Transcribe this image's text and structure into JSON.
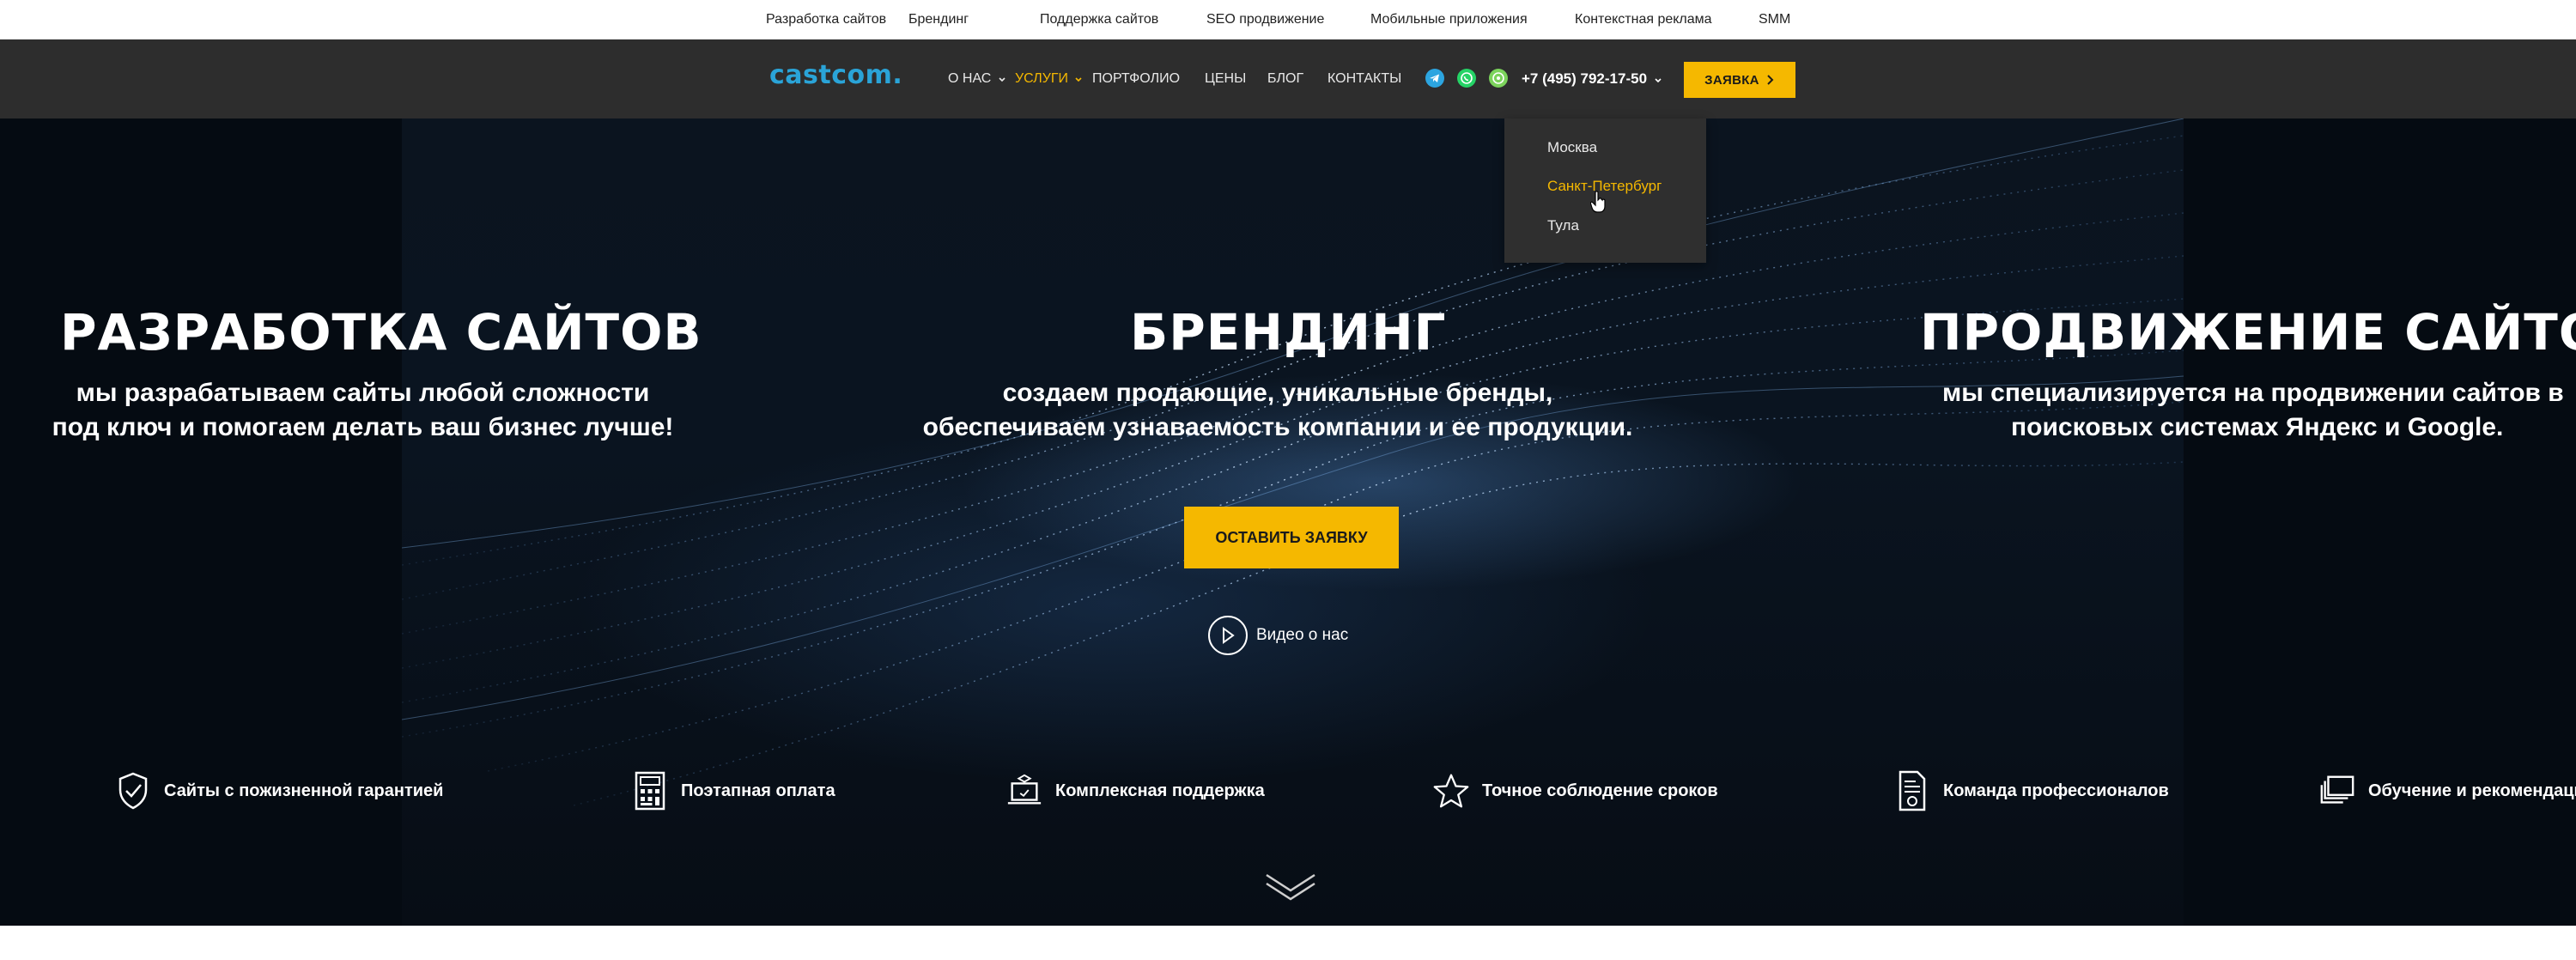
{
  "top_links": [
    "Разработка сайтов",
    "Брендинг",
    "Поддержка сайтов",
    "SEO продвижение",
    "Мобильные приложения",
    "Контекстная реклама",
    "SMM"
  ],
  "header": {
    "logo": "castcom.",
    "nav": [
      {
        "label": "О НАС",
        "has_caret": true
      },
      {
        "label": "УСЛУГИ",
        "has_caret": true,
        "active": true
      },
      {
        "label": "ПОРТФОЛИО"
      },
      {
        "label": "ЦЕНЫ"
      },
      {
        "label": "БЛОГ"
      },
      {
        "label": "КОНТАКТЫ"
      }
    ],
    "social_icons": [
      "telegram-icon",
      "whatsapp-icon",
      "viber-icon"
    ],
    "phone": "+7 (495) 792-17-50",
    "cta_label": "ЗАЯВКА"
  },
  "city_dropdown": {
    "items": [
      "Москва",
      "Санкт-Петербург",
      "Тула"
    ],
    "hovered": "Санкт-Петербург"
  },
  "hero": {
    "slides": [
      {
        "title": "РАЗРАБОТКА САЙТОВ",
        "line1": "мы разрабатываем сайты любой сложности",
        "line2": "под ключ и помогаем делать ваш бизнес лучше!"
      },
      {
        "title": "БРЕНДИНГ",
        "line1": "создаем продающие, уникальные бренды,",
        "line2": "обеспечиваем узнаваемость компании и ее продукции."
      },
      {
        "title": "ПРОДВИЖЕНИЕ САЙТОВ",
        "line1": "мы  специализируется на продвижении сайтов в",
        "line2": "поисковых системах Яндекс и Google."
      }
    ],
    "cta_label": "ОСТАВИТЬ ЗАЯВКУ",
    "video_label": "Видео о нас"
  },
  "features": [
    {
      "icon": "shield-check-icon",
      "label": "Сайты с пожизненной гарантией"
    },
    {
      "icon": "calculator-icon",
      "label": "Поэтапная оплата"
    },
    {
      "icon": "laptop-support-icon",
      "label": "Комплексная поддержка"
    },
    {
      "icon": "star-icon",
      "label": "Точное соблюдение сроков"
    },
    {
      "icon": "document-team-icon",
      "label": "Команда профессионалов"
    },
    {
      "icon": "layers-icon",
      "label": "Обучение и рекомендации"
    }
  ],
  "colors": {
    "accent": "#f5b800",
    "header_bg": "#2d2d2d",
    "logo": "#2aa4d8",
    "hero_bg": "#050b12"
  }
}
